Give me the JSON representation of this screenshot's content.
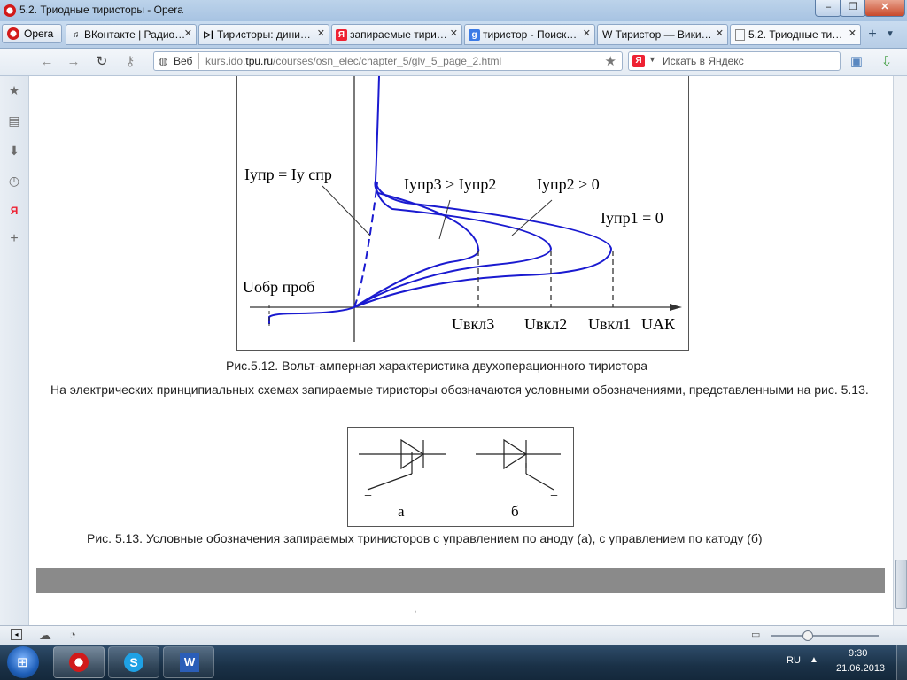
{
  "window": {
    "title": "5.2. Триодные тиристоры - Opera",
    "controls": [
      "‒",
      "❐",
      "✕"
    ]
  },
  "tabs": {
    "menu_label": "Opera",
    "items": [
      {
        "label": "ВКонтакте | Радио…",
        "icon": "music-note-icon"
      },
      {
        "label": "Тиристоры: дини…",
        "icon": "diode-icon"
      },
      {
        "label": "запираемые тири…",
        "icon": "yandex-icon"
      },
      {
        "label": "тиристор - Поиск…",
        "icon": "google-icon"
      },
      {
        "label": "W Тиристор — Вики…",
        "icon": "wikipedia-icon"
      },
      {
        "label": "5.2. Триодные ти…",
        "icon": "page-icon"
      }
    ],
    "new_tab": "+"
  },
  "nav": {
    "web_label": "Веб",
    "url_domain": "kurs.ido.",
    "url_bold": "tpu.ru",
    "url_path": "/courses/osn_elec/chapter_5/glv_5_page_2.html",
    "search_placeholder": "Искать в Яндекс"
  },
  "content": {
    "figure1": {
      "labels": {
        "iupr_eq": "Iупр = Iу спр",
        "iupr3": "Iупр3 > Iупр2",
        "iupr2": "Iупр2 > 0",
        "iupr1": "Iупр1 = 0",
        "uobr": "Uобр проб",
        "uvkl3": "Uвкл3",
        "uvkl2": "Uвкл2",
        "uvkl1": "Uвкл1",
        "uak": "UАК"
      },
      "caption": "Рис.5.12. Вольт-амперная характеристика двухоперационного тиристора"
    },
    "paragraph": "На электрических принципиальных схемах запираемые тиристоры обозначаются условными обозначениями, представленными на рис. 5.13.",
    "figure2": {
      "label_a": "а",
      "label_b": "б",
      "plus": "+",
      "caption": "Рис. 5.13. Условные обозначения запираемых тринисторов с управлением по аноду (а), с управлением по катоду (б)"
    },
    "footer_comma": ","
  },
  "taskbar": {
    "lang": "RU",
    "time": "9:30",
    "date": "21.06.2013"
  }
}
